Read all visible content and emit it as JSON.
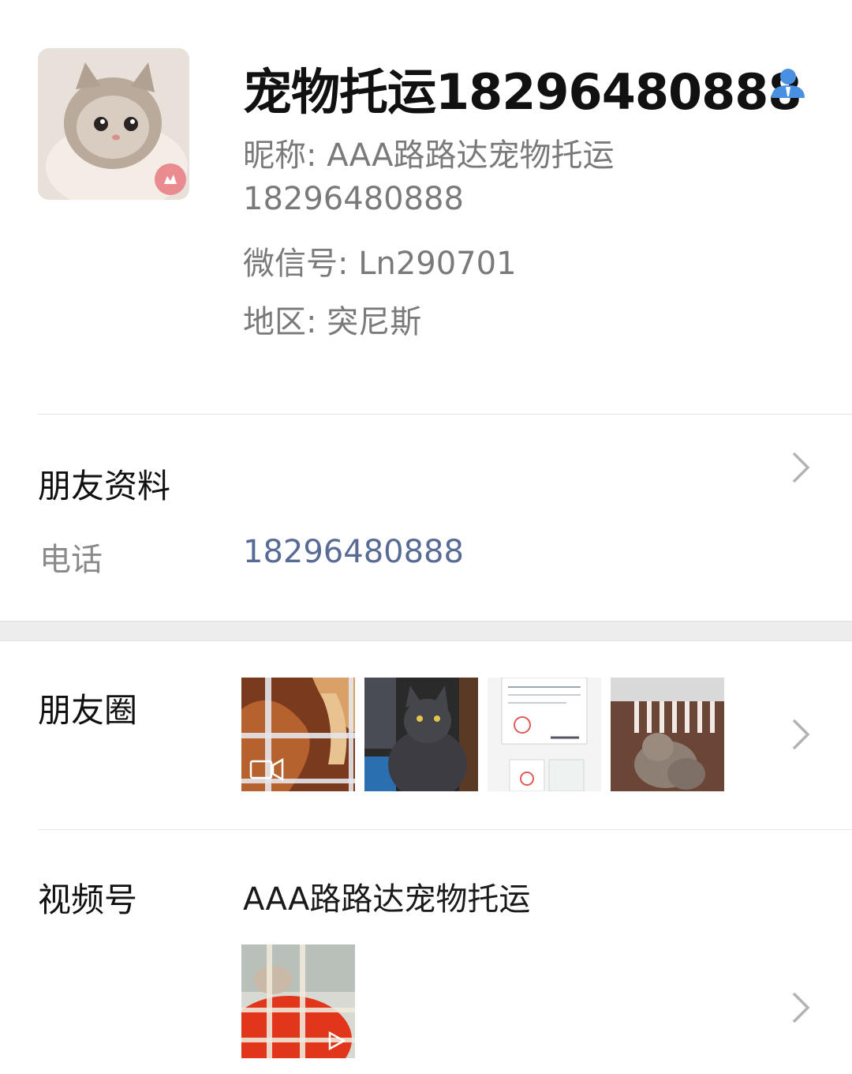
{
  "profile": {
    "display_name": "宠物托运18296480888",
    "nickname": "昵称: AAA路路达宠物托运",
    "phone_line": "18296480888",
    "wechat_id": "微信号: Ln290701",
    "region": "地区: 突尼斯",
    "contact_icon": "person-icon",
    "accent_color": "#4a90e2"
  },
  "friend_info": {
    "title": "朋友资料",
    "phone_label": "电话",
    "phone_value": "18296480888",
    "link_color": "#576b95"
  },
  "moments": {
    "title": "朋友圈",
    "thumbnails": [
      {
        "icon": "video-camera-icon"
      },
      {
        "icon": "black-cat-photo"
      },
      {
        "icon": "document-photo"
      },
      {
        "icon": "kitten-in-carrier-photo"
      }
    ]
  },
  "channels": {
    "title": "视频号",
    "channel_name": "AAA路路达宠物托运",
    "thumbnail_icon": "play-icon"
  }
}
